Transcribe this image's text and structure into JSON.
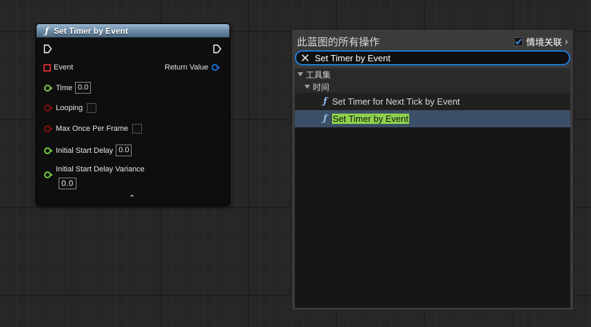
{
  "node": {
    "fx_glyph": "ƒ",
    "title": "Set Timer by Event",
    "event_label": "Event",
    "return_label": "Return Value",
    "time_label": "Time",
    "time_value": "0.0",
    "looping_label": "Looping",
    "looping_checked": false,
    "max_once_label": "Max Once Per Frame",
    "max_once_checked": false,
    "initial_delay_label": "Initial Start Delay",
    "initial_delay_value": "0.0",
    "initial_variance_label": "Initial Start Delay Variance",
    "initial_variance_value": "0.0",
    "collapse_glyph": "⌃",
    "colors": {
      "header": "#6f8ea9",
      "exec_pin": "#ffffff",
      "delegate_pin": "#e03030",
      "float_pin": "#7ad04a",
      "bool_pin": "#8a1010",
      "struct_pin": "#1a6fd8"
    }
  },
  "menu": {
    "title": "此蓝图的所有操作",
    "context_label": "情境关联",
    "context_checked": true,
    "search": {
      "value": "Set Timer by Event",
      "placeholder": ""
    },
    "categories": [
      {
        "label": "工具集"
      },
      {
        "label": "时间"
      }
    ],
    "items": [
      {
        "glyph": "ƒ",
        "label": "Set Timer for Next Tick by Event",
        "selected": false
      },
      {
        "glyph": "ƒ",
        "label": "Set Timer by Event",
        "selected": true
      }
    ],
    "colors": {
      "search_border": "#1e7ad6",
      "selection_bg": "#3b4f66",
      "highlight": "#8ed24c"
    }
  }
}
